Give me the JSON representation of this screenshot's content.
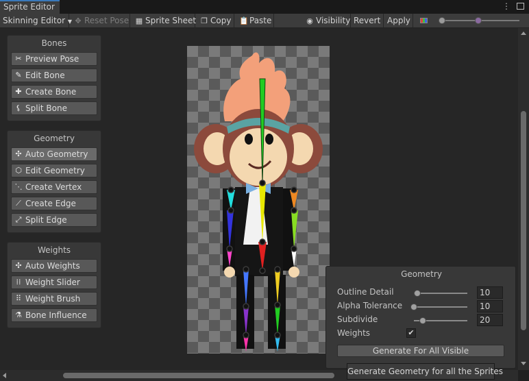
{
  "window": {
    "tab_title": "Sprite Editor"
  },
  "toolbar": {
    "mode_dropdown": "Skinning Editor",
    "reset_pose": "Reset Pose",
    "sprite_sheet": "Sprite Sheet",
    "copy": "Copy",
    "paste": "Paste",
    "visibility": "Visibility",
    "revert": "Revert",
    "apply": "Apply"
  },
  "panels": {
    "bones": {
      "title": "Bones",
      "items": [
        {
          "label": "Preview Pose",
          "icon": "preview-pose-icon"
        },
        {
          "label": "Edit Bone",
          "icon": "edit-bone-icon"
        },
        {
          "label": "Create Bone",
          "icon": "create-bone-icon"
        },
        {
          "label": "Split Bone",
          "icon": "split-bone-icon"
        }
      ]
    },
    "geometry": {
      "title": "Geometry",
      "items": [
        {
          "label": "Auto Geometry",
          "icon": "auto-geometry-icon",
          "active": true
        },
        {
          "label": "Edit Geometry",
          "icon": "edit-geometry-icon"
        },
        {
          "label": "Create Vertex",
          "icon": "create-vertex-icon"
        },
        {
          "label": "Create Edge",
          "icon": "create-edge-icon"
        },
        {
          "label": "Split Edge",
          "icon": "split-edge-icon"
        }
      ]
    },
    "weights": {
      "title": "Weights",
      "items": [
        {
          "label": "Auto Weights",
          "icon": "auto-weights-icon"
        },
        {
          "label": "Weight Slider",
          "icon": "weight-slider-icon"
        },
        {
          "label": "Weight Brush",
          "icon": "weight-brush-icon"
        },
        {
          "label": "Bone Influence",
          "icon": "bone-influence-icon"
        }
      ]
    }
  },
  "geometry_popup": {
    "title": "Geometry",
    "outline_detail": {
      "label": "Outline Detail",
      "value": "10"
    },
    "alpha_tolerance": {
      "label": "Alpha Tolerance",
      "value": "10"
    },
    "subdivide": {
      "label": "Subdivide",
      "value": "20"
    },
    "weights": {
      "label": "Weights",
      "checked": true
    },
    "generate_button": "Generate For All Visible"
  },
  "tooltip": "Generate Geometry for all the Sprites",
  "colors": {
    "accent": "#3a79bb",
    "bone_green": "#22cc22",
    "bone_yellow": "#e8e800",
    "bone_red": "#e02020"
  }
}
